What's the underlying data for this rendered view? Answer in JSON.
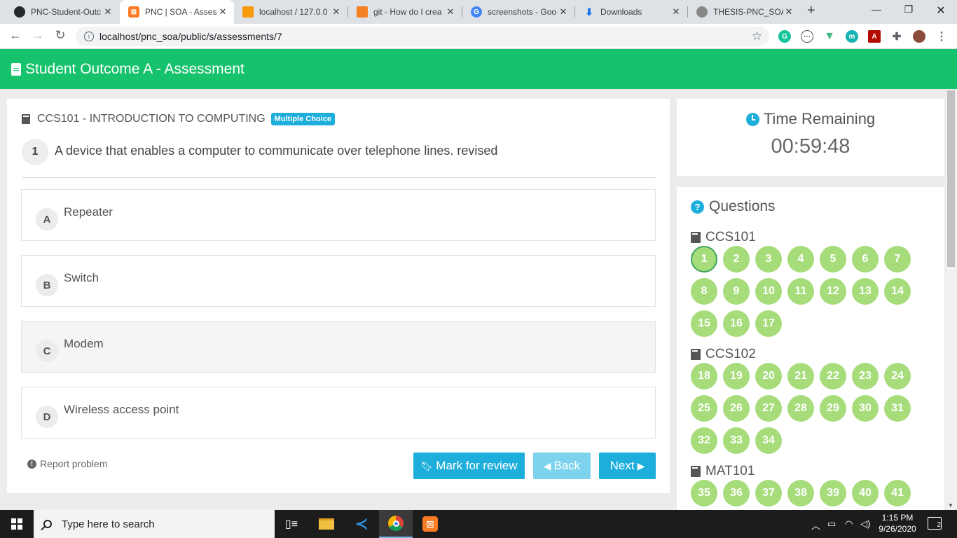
{
  "browser": {
    "tabs": [
      {
        "label": "PNC-Student-Outc",
        "icon": "github-icon"
      },
      {
        "label": "PNC | SOA - Asses",
        "icon": "xampp-icon"
      },
      {
        "label": "localhost / 127.0.0",
        "icon": "phpmyadmin-icon"
      },
      {
        "label": "git - How do I crea",
        "icon": "stackoverflow-icon"
      },
      {
        "label": "screenshots - Goo",
        "icon": "google-icon"
      },
      {
        "label": "Downloads",
        "icon": "download-icon"
      },
      {
        "label": "THESIS-PNC_SOA-",
        "icon": "github-icon"
      }
    ],
    "url": "localhost/pnc_soa/public/s/assessments/7"
  },
  "app": {
    "title": "Student Outcome A - Assessment",
    "accent": "#16c26b"
  },
  "question": {
    "course": "CCS101 - INTRODUCTION TO COMPUTING",
    "type_badge": "Multiple Choice",
    "number": "1",
    "text": "A device that enables a computer to communicate over telephone lines. revised",
    "choices": [
      {
        "letter": "A",
        "text": "Repeater",
        "selected": false
      },
      {
        "letter": "B",
        "text": "Switch",
        "selected": false
      },
      {
        "letter": "C",
        "text": "Modem",
        "selected": true
      },
      {
        "letter": "D",
        "text": "Wireless access point",
        "selected": false
      }
    ],
    "report_label": "Report problem",
    "mark_label": "Mark for review",
    "back_label": "Back",
    "next_label": "Next"
  },
  "timer": {
    "label": "Time Remaining",
    "value": "00:59:48"
  },
  "questions_panel": {
    "title": "Questions",
    "current": 1,
    "sections": [
      {
        "name": "CCS101",
        "items": [
          "1",
          "2",
          "3",
          "4",
          "5",
          "6",
          "7",
          "8",
          "9",
          "10",
          "11",
          "12",
          "13",
          "14",
          "15",
          "16",
          "17"
        ]
      },
      {
        "name": "CCS102",
        "items": [
          "18",
          "19",
          "20",
          "21",
          "22",
          "23",
          "24",
          "25",
          "26",
          "27",
          "28",
          "29",
          "30",
          "31",
          "32",
          "33",
          "34"
        ]
      },
      {
        "name": "MAT101",
        "items": [
          "35",
          "36",
          "37",
          "38",
          "39",
          "40",
          "41"
        ]
      }
    ]
  },
  "taskbar": {
    "search_placeholder": "Type here to search",
    "time": "1:15 PM",
    "date": "9/26/2020",
    "notifications": "2"
  }
}
